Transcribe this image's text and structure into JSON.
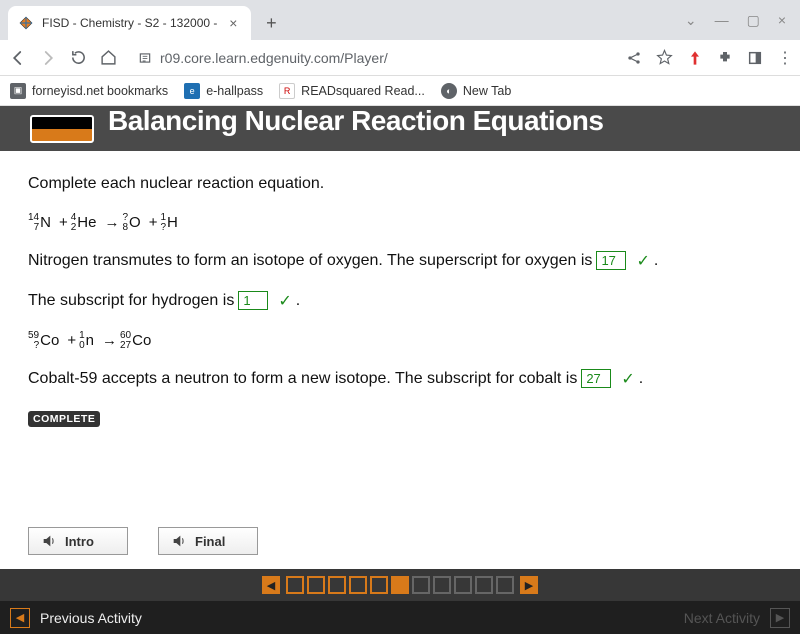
{
  "browser": {
    "tab_title": "FISD - Chemistry - S2 - 132000 -",
    "url_display": "r09.core.learn.edgenuity.com/Player/",
    "bookmarks": [
      {
        "label": "forneyisd.net bookmarks",
        "icon": "folder"
      },
      {
        "label": "e-hallpass",
        "icon": "eh"
      },
      {
        "label": "READsquared Read...",
        "icon": "rs"
      },
      {
        "label": "New Tab",
        "icon": "globe"
      }
    ]
  },
  "header": {
    "title": "Balancing Nuclear Reaction Equations"
  },
  "content": {
    "prompt": "Complete each nuclear reaction equation.",
    "eq1": {
      "a": {
        "top": "14",
        "bot": "7",
        "sym": "N"
      },
      "plus1": "+",
      "b": {
        "top": "4",
        "bot": "2",
        "sym": "He"
      },
      "arrow": "→",
      "c": {
        "top": "?",
        "bot": "8",
        "sym": "O"
      },
      "plus2": "+",
      "d": {
        "top": "1",
        "bot": "?",
        "sym": "H"
      }
    },
    "line1_pre": "Nitrogen transmutes to form an isotope of oxygen. The superscript for oxygen is",
    "ans1": "17",
    "line1_post": ".",
    "line2_pre": "The subscript for hydrogen is",
    "ans2": "1",
    "line2_post": ".",
    "eq2": {
      "a": {
        "top": "59",
        "bot": "?",
        "sym": "Co"
      },
      "plus1": "+",
      "b": {
        "top": "1",
        "bot": "0",
        "sym": "n"
      },
      "arrow": "→",
      "c": {
        "top": "60",
        "bot": "27",
        "sym": "Co"
      }
    },
    "line3_pre": "Cobalt-59 accepts a neutron to form a new isotope. The subscript for cobalt is",
    "ans3": "27",
    "line3_post": ".",
    "complete": "COMPLETE"
  },
  "buttons": {
    "intro": "Intro",
    "final": "Final"
  },
  "progress": {
    "total": 11,
    "filled": [
      0,
      1,
      2,
      3,
      4,
      5
    ],
    "current": 5
  },
  "footer": {
    "prev": "Previous Activity",
    "next": "Next Activity"
  }
}
